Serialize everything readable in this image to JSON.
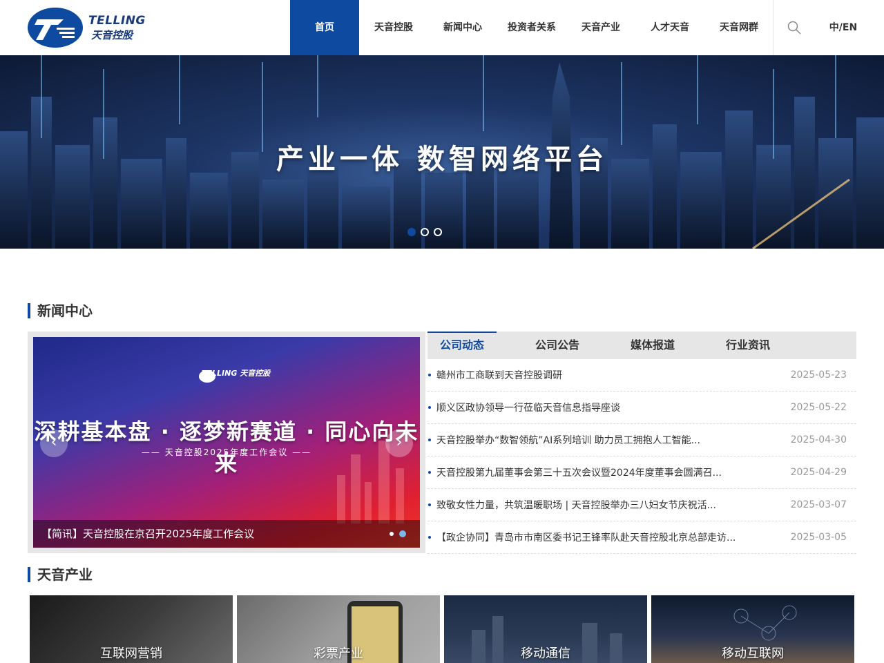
{
  "header": {
    "logo_en": "TELLING",
    "logo_cn": "天音控股",
    "nav": [
      "首页",
      "天音控股",
      "新闻中心",
      "投资者关系",
      "天音产业",
      "人才天音",
      "天音网群"
    ],
    "lang": "中/EN"
  },
  "banner": {
    "title": "产业一体  数智网络平台",
    "slide_count": 3,
    "active_index": 0
  },
  "news": {
    "section_title": "新闻中心",
    "slider": {
      "logo_text": "TELLING 天音控股",
      "headline": "深耕基本盘 · 逐梦新赛道 · 同心向未来",
      "subline": "—— 天音控股2025年度工作会议 ——",
      "caption": "【简讯】天音控股在京召开2025年度工作会议"
    },
    "tabs": [
      "公司动态",
      "公司公告",
      "媒体报道",
      "行业资讯"
    ],
    "items": [
      {
        "title": "赣州市工商联到天音控股调研",
        "date": "2025-05-23"
      },
      {
        "title": "顺义区政协领导一行莅临天音信息指导座谈",
        "date": "2025-05-22"
      },
      {
        "title": "天音控股举办“数智领航”AI系列培训 助力员工拥抱人工智能...",
        "date": "2025-04-30"
      },
      {
        "title": "天音控股第九届董事会第三十五次会议暨2024年度董事会圆满召...",
        "date": "2025-04-29"
      },
      {
        "title": "致敬女性力量，共筑温暖职场 | 天音控股举办三八妇女节庆祝活...",
        "date": "2025-03-07"
      },
      {
        "title": "【政企协同】青岛市市南区委书记王锋率队赴天音控股北京总部走访...",
        "date": "2025-03-05"
      }
    ]
  },
  "industry": {
    "section_title": "天音产业",
    "cards": [
      "互联网营销",
      "彩票产业",
      "移动通信",
      "移动互联网"
    ]
  }
}
